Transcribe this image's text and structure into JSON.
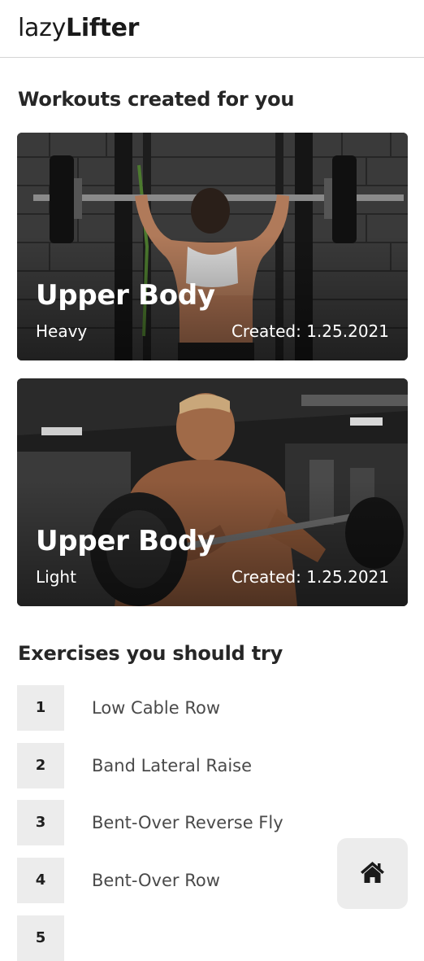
{
  "header": {
    "logo_light": "lazy",
    "logo_bold": "Lifter"
  },
  "workouts": {
    "title": "Workouts created for you",
    "cards": [
      {
        "title": "Upper Body",
        "intensity": "Heavy",
        "created": "Created: 1.25.2021"
      },
      {
        "title": "Upper Body",
        "intensity": "Light",
        "created": "Created: 1.25.2021"
      }
    ]
  },
  "exercises": {
    "title": "Exercises you should try",
    "items": [
      {
        "number": "1",
        "name": "Low Cable Row"
      },
      {
        "number": "2",
        "name": "Band Lateral Raise"
      },
      {
        "number": "3",
        "name": "Bent-Over Reverse Fly"
      },
      {
        "number": "4",
        "name": "Bent-Over Row"
      },
      {
        "number": "5",
        "name": ""
      }
    ]
  },
  "nav": {
    "home_icon": "home-icon"
  }
}
